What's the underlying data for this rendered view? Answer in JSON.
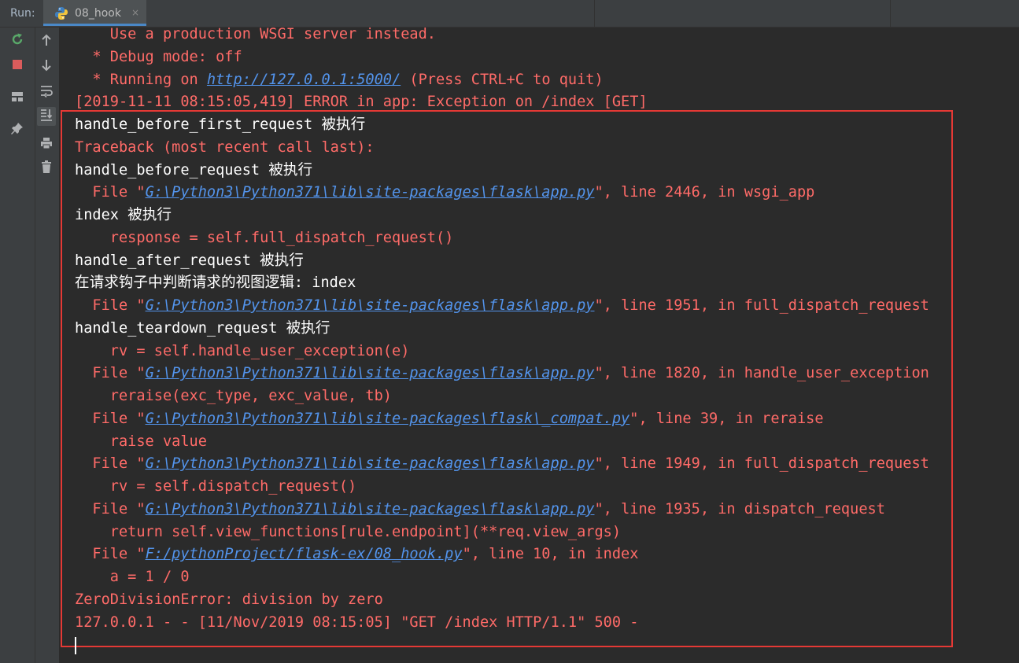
{
  "run_label": "Run:",
  "tab": {
    "label": "08_hook",
    "close": "×"
  },
  "toolbar_left": [
    {
      "icon": "rerun-icon",
      "color": "#59a869"
    },
    {
      "icon": "stop-icon",
      "color": "#db5c5c"
    },
    {
      "icon": "layout-icon",
      "color": "#afb1b3"
    },
    {
      "icon": "pin-icon",
      "color": "#afb1b3"
    }
  ],
  "toolbar_right": [
    {
      "icon": "up-arrow-icon"
    },
    {
      "icon": "down-arrow-icon"
    },
    {
      "icon": "soft-wrap-icon"
    },
    {
      "icon": "scroll-to-end-icon",
      "active": true
    },
    {
      "icon": "print-icon"
    },
    {
      "icon": "trash-icon"
    }
  ],
  "lines": [
    {
      "kind": "err",
      "segments": [
        {
          "text": "    Use a production WSGI server instead."
        }
      ]
    },
    {
      "kind": "err",
      "segments": [
        {
          "text": "  * Debug mode: off"
        }
      ]
    },
    {
      "kind": "err",
      "segments": [
        {
          "text": "  * Running on "
        },
        {
          "text": "http://127.0.0.1:5000/",
          "link": true
        },
        {
          "text": " (Press CTRL+C to quit)"
        }
      ]
    },
    {
      "kind": "err",
      "segments": [
        {
          "text": "[2019-11-11 08:15:05,419] ERROR in app: Exception on /index [GET]"
        }
      ]
    },
    {
      "kind": "out",
      "segments": [
        {
          "text": "handle_before_first_request 被执行"
        }
      ]
    },
    {
      "kind": "err",
      "segments": [
        {
          "text": "Traceback (most recent call last):"
        }
      ]
    },
    {
      "kind": "out",
      "segments": [
        {
          "text": "handle_before_request 被执行"
        }
      ]
    },
    {
      "kind": "err",
      "segments": [
        {
          "text": "  File \""
        },
        {
          "text": "G:\\Python3\\Python371\\lib\\site-packages\\flask\\app.py",
          "link": true
        },
        {
          "text": "\", line 2446, in wsgi_app"
        }
      ]
    },
    {
      "kind": "out",
      "segments": [
        {
          "text": "index 被执行"
        }
      ]
    },
    {
      "kind": "err",
      "segments": [
        {
          "text": "    response = self.full_dispatch_request()"
        }
      ]
    },
    {
      "kind": "out",
      "segments": [
        {
          "text": "handle_after_request 被执行"
        }
      ]
    },
    {
      "kind": "out",
      "segments": [
        {
          "text": "在请求钩子中判断请求的视图逻辑: index"
        }
      ]
    },
    {
      "kind": "err",
      "segments": [
        {
          "text": "  File \""
        },
        {
          "text": "G:\\Python3\\Python371\\lib\\site-packages\\flask\\app.py",
          "link": true
        },
        {
          "text": "\", line 1951, in full_dispatch_request"
        }
      ]
    },
    {
      "kind": "out",
      "segments": [
        {
          "text": "handle_teardown_request 被执行"
        }
      ]
    },
    {
      "kind": "err",
      "segments": [
        {
          "text": "    rv = self.handle_user_exception(e)"
        }
      ]
    },
    {
      "kind": "err",
      "segments": [
        {
          "text": "  File \""
        },
        {
          "text": "G:\\Python3\\Python371\\lib\\site-packages\\flask\\app.py",
          "link": true
        },
        {
          "text": "\", line 1820, in handle_user_exception"
        }
      ]
    },
    {
      "kind": "err",
      "segments": [
        {
          "text": "    reraise(exc_type, exc_value, tb)"
        }
      ]
    },
    {
      "kind": "err",
      "segments": [
        {
          "text": "  File \""
        },
        {
          "text": "G:\\Python3\\Python371\\lib\\site-packages\\flask\\_compat.py",
          "link": true
        },
        {
          "text": "\", line 39, in reraise"
        }
      ]
    },
    {
      "kind": "err",
      "segments": [
        {
          "text": "    raise value"
        }
      ]
    },
    {
      "kind": "err",
      "segments": [
        {
          "text": "  File \""
        },
        {
          "text": "G:\\Python3\\Python371\\lib\\site-packages\\flask\\app.py",
          "link": true
        },
        {
          "text": "\", line 1949, in full_dispatch_request"
        }
      ]
    },
    {
      "kind": "err",
      "segments": [
        {
          "text": "    rv = self.dispatch_request()"
        }
      ]
    },
    {
      "kind": "err",
      "segments": [
        {
          "text": "  File \""
        },
        {
          "text": "G:\\Python3\\Python371\\lib\\site-packages\\flask\\app.py",
          "link": true
        },
        {
          "text": "\", line 1935, in dispatch_request"
        }
      ]
    },
    {
      "kind": "err",
      "segments": [
        {
          "text": "    return self.view_functions[rule.endpoint](**req.view_args)"
        }
      ]
    },
    {
      "kind": "err",
      "segments": [
        {
          "text": "  File \""
        },
        {
          "text": "F:/pythonProject/flask-ex/08_hook.py",
          "link": true
        },
        {
          "text": "\", line 10, in index"
        }
      ]
    },
    {
      "kind": "err",
      "segments": [
        {
          "text": "    a = 1 / 0"
        }
      ]
    },
    {
      "kind": "err",
      "segments": [
        {
          "text": "ZeroDivisionError: division by zero"
        }
      ]
    },
    {
      "kind": "err",
      "segments": [
        {
          "text": "127.0.0.1 - - [11/Nov/2019 08:15:05] \"GET /index HTTP/1.1\" 500 -"
        }
      ]
    }
  ]
}
